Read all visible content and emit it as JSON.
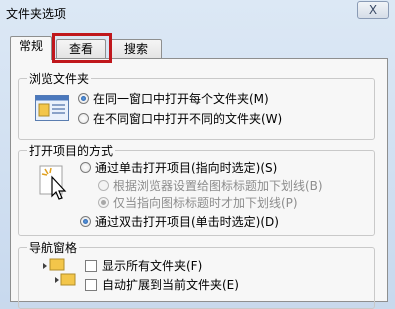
{
  "window": {
    "title": "文件夹选项",
    "close_glyph": "X"
  },
  "tabs": [
    {
      "label": "常规",
      "active": true
    },
    {
      "label": "查看",
      "active": false,
      "highlighted": true
    },
    {
      "label": "搜索",
      "active": false
    }
  ],
  "browse_folders": {
    "title": "浏览文件夹",
    "options": [
      {
        "label": "在同一窗口中打开每个文件夹(M)",
        "checked": true
      },
      {
        "label": "在不同窗口中打开不同的文件夹(W)",
        "checked": false
      }
    ]
  },
  "click_items": {
    "title": "打开项目的方式",
    "single_click": {
      "label": "通过单击打开项目(指向时选定)(S)",
      "checked": false
    },
    "sub_options": [
      {
        "label": "根据浏览器设置给图标标题加下划线(B)",
        "checked": false
      },
      {
        "label": "仅当指向图标标题时才加下划线(P)",
        "checked": true
      }
    ],
    "double_click": {
      "label": "通过双击打开项目(单击时选定)(D)",
      "checked": true
    }
  },
  "nav_pane": {
    "title": "导航窗格",
    "options": [
      {
        "label": "显示所有文件夹(F)",
        "checked": false
      },
      {
        "label": "自动扩展到当前文件夹(E)",
        "checked": false
      }
    ]
  },
  "colors": {
    "highlight": "#c0171c",
    "accent": "#1d4f9a"
  }
}
